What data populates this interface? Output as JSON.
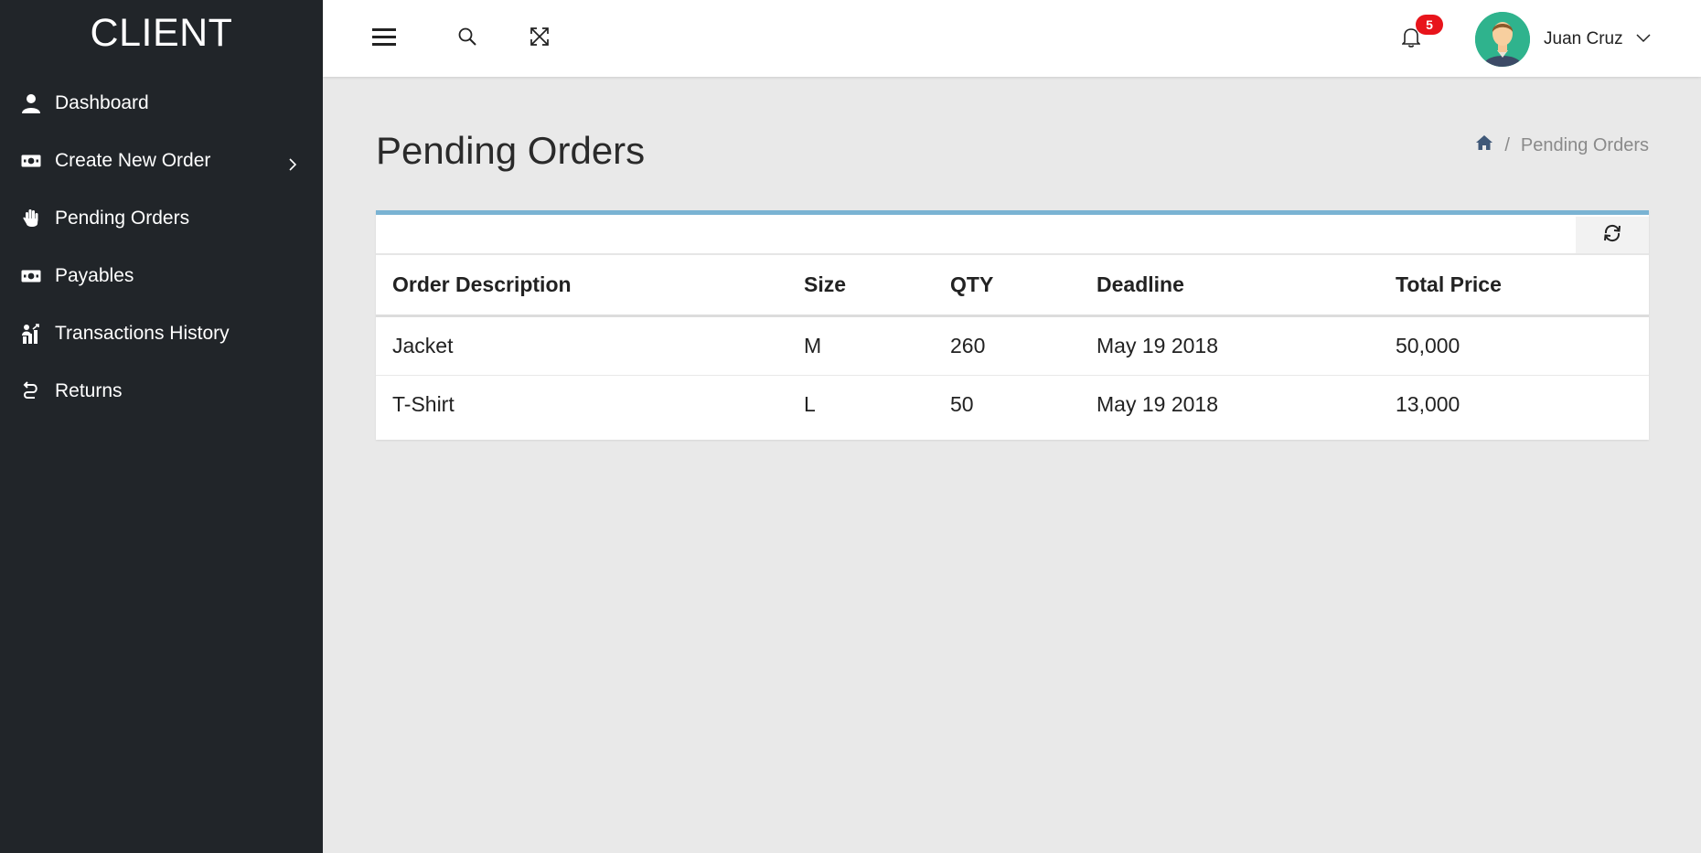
{
  "brand": "CLIENT",
  "sidebar": {
    "items": [
      {
        "label": "Dashboard",
        "icon": "user-icon"
      },
      {
        "label": "Create New Order",
        "icon": "money-icon",
        "has_submenu": true
      },
      {
        "label": "Pending Orders",
        "icon": "hand-icon"
      },
      {
        "label": "Payables",
        "icon": "money-icon"
      },
      {
        "label": "Transactions History",
        "icon": "chart-person-icon"
      },
      {
        "label": "Returns",
        "icon": "return-icon"
      }
    ]
  },
  "topbar": {
    "notifications_count": "5",
    "user_name": "Juan Cruz"
  },
  "page": {
    "title": "Pending Orders",
    "breadcrumb_current": "Pending Orders"
  },
  "table": {
    "headers": [
      "Order Description",
      "Size",
      "QTY",
      "Deadline",
      "Total Price"
    ],
    "rows": [
      [
        "Jacket",
        "M",
        "260",
        "May 19 2018",
        "50,000"
      ],
      [
        "T-Shirt",
        "L",
        "50",
        "May 19 2018",
        "13,000"
      ]
    ]
  },
  "colors": {
    "sidebar_bg": "#212529",
    "card_accent": "#7ab3d3",
    "badge": "#e8141b",
    "avatar_bg": "#2fb38d"
  }
}
